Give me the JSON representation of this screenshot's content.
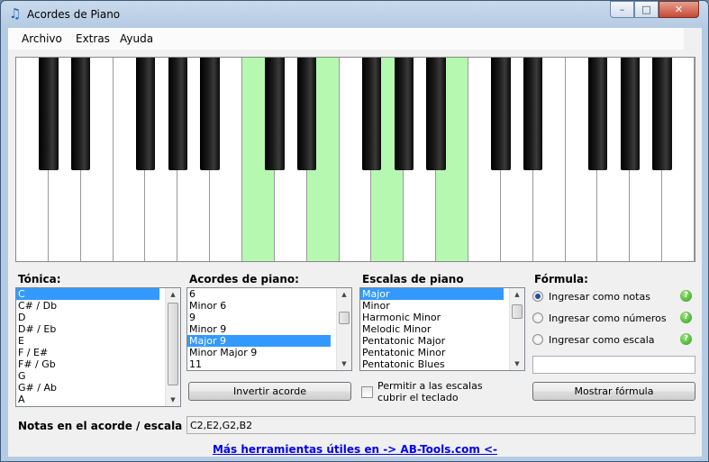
{
  "window": {
    "title": "Acordes de Piano",
    "minimize": "–",
    "maximize": "□",
    "close": "✕",
    "icon": "music-note-icon"
  },
  "menu": [
    "Archivo",
    "Extras",
    "Ayuda"
  ],
  "piano": {
    "white_key_count": 21,
    "highlighted_white_keys": [
      7,
      9,
      11,
      13
    ],
    "highlight_color": "#b6f8b0"
  },
  "tonica": {
    "label": "Tónica:",
    "items": [
      "C",
      "C# / Db",
      "D",
      "D# / Eb",
      "E",
      "F / E#",
      "F# / Gb",
      "G",
      "G# / Ab",
      "A"
    ],
    "selected": "C"
  },
  "acordes": {
    "label": "Acordes de piano:",
    "items": [
      "6",
      "Minor 6",
      "9",
      "Minor 9",
      "Major 9",
      "Minor Major 9",
      "11"
    ],
    "selected": "Major 9"
  },
  "escalas": {
    "label": "Escalas de piano",
    "items": [
      "Major",
      "Minor",
      "Harmonic Minor",
      "Melodic Minor",
      "Pentatonic Major",
      "Pentatonic Minor",
      "Pentatonic Blues"
    ],
    "selected": "Major"
  },
  "formula": {
    "label": "Fórmula:",
    "options": [
      "Ingresar como notas",
      "Ingresar como números",
      "Ingresar como escala"
    ],
    "selected_index": 0,
    "input_value": "",
    "button": "Mostrar fórmula"
  },
  "buttons": {
    "invertir": "Invertir acorde"
  },
  "checkbox": {
    "label": "Permitir a las escalas cubrir el teclado",
    "checked": false
  },
  "notas": {
    "label": "Notas en el acorde / escala",
    "value": "C2,E2,G2,B2"
  },
  "footer_link": "Más herramientas útiles en -> AB-Tools.com <-"
}
